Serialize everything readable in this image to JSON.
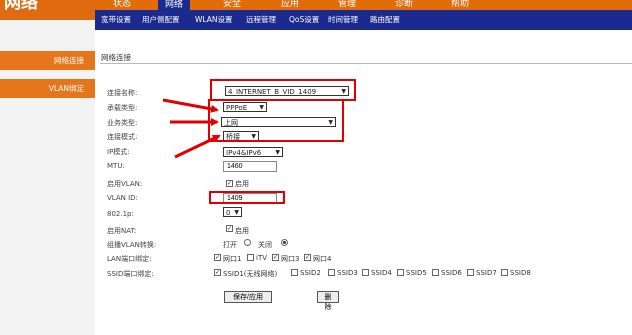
{
  "logo": {
    "text": "网络"
  },
  "topnav": [
    {
      "label": "状态",
      "active": false
    },
    {
      "label": "网络",
      "active": true
    },
    {
      "label": "安全",
      "active": false
    },
    {
      "label": "应用",
      "active": false
    },
    {
      "label": "管理",
      "active": false
    },
    {
      "label": "诊断",
      "active": false
    },
    {
      "label": "帮助",
      "active": false
    }
  ],
  "subnav": [
    "宽带设置",
    "用户侧配置",
    "WLAN设置",
    "远程管理",
    "QoS设置",
    "时间管理",
    "路由配置"
  ],
  "sidebar": [
    {
      "label": "网络连接"
    },
    {
      "label": "VLAN绑定"
    }
  ],
  "main": {
    "page_title": "网络连接",
    "fields": {
      "conn_name": {
        "label": "连接名称:",
        "value": "4_INTERNET_B_VID_1409"
      },
      "conn_type": {
        "label": "承载类型:",
        "value": "PPPoE"
      },
      "service_type": {
        "label": "业务类型:",
        "value": "上网"
      },
      "conn_mode": {
        "label": "连接模式:",
        "value": "桥接"
      },
      "ip_mode": {
        "label": "IP模式:",
        "value": "IPv4&IPv6"
      },
      "mtu": {
        "label": "MTU:",
        "value": "1460"
      },
      "vlan_enable": {
        "label": "启用VLAN:",
        "checkbox_label": "启用",
        "checked": true
      },
      "vlan_id": {
        "label": "VLAN ID:",
        "value": "1409"
      },
      "dot1p": {
        "label": "802.1p:",
        "value": "0"
      },
      "nat_enable": {
        "label": "启用NAT:",
        "checkbox_label": "启用",
        "checked": true
      },
      "multicast": {
        "label": "组播VLAN转换:",
        "options": [
          "打开",
          "关闭"
        ],
        "selected": "关闭"
      },
      "lan_bind": {
        "label": "LAN端口绑定:",
        "ports": [
          {
            "label": "网口1",
            "checked": true
          },
          {
            "label": "iTV",
            "checked": false
          },
          {
            "label": "网口3",
            "checked": true
          },
          {
            "label": "网口4",
            "checked": true
          }
        ]
      },
      "ssid_bind": {
        "label": "SSID端口绑定:",
        "ssids": [
          {
            "label": "SSID1(无线网络)",
            "checked": true
          },
          {
            "label": "SSID2",
            "checked": false
          },
          {
            "label": "SSID3",
            "checked": false
          },
          {
            "label": "SSID4",
            "checked": false
          },
          {
            "label": "SSID5",
            "checked": false
          },
          {
            "label": "SSID6",
            "checked": false
          },
          {
            "label": "SSID7",
            "checked": false
          },
          {
            "label": "SSID8",
            "checked": false
          }
        ]
      }
    },
    "buttons": {
      "save": "保存/应用",
      "delete": "删除"
    }
  },
  "colors": {
    "nav_orange": "#e36c0a",
    "nav_blue": "#1b2a8f",
    "highlight_red": "#e00000"
  }
}
